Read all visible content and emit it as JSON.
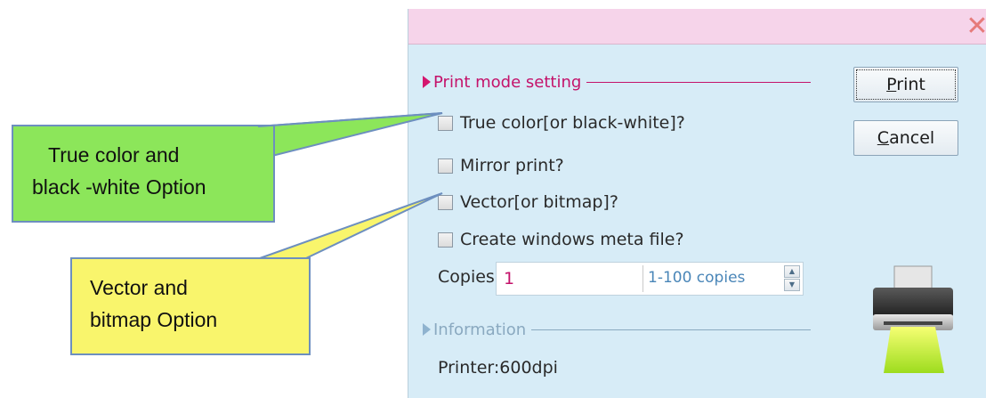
{
  "dialog": {
    "close_glyph": "✕",
    "print_mode_section": "Print mode setting",
    "options": [
      {
        "label": "True color[or black-white]?",
        "checked": false
      },
      {
        "label": "Mirror print?",
        "checked": false
      },
      {
        "label": "Vector[or bitmap]?",
        "checked": false
      },
      {
        "label": "Create windows meta file?",
        "checked": false
      }
    ],
    "copies_label": "Copies:",
    "copies_value": "1",
    "copies_hint": "1-100 copies",
    "information_section": "Information",
    "printer_info": "Printer:600dpi",
    "buttons": {
      "print_label": "rint",
      "print_mnemonic": "P",
      "cancel_label": "ancel",
      "cancel_mnemonic": "C"
    },
    "icons": [
      "close-icon",
      "printer-icon",
      "spin-up-icon",
      "spin-down-icon"
    ]
  },
  "callouts": [
    {
      "line1": "True color and",
      "line2": "black -white Option",
      "color": "#8ce65a"
    },
    {
      "line1": "Vector and",
      "line2": "bitmap Option",
      "color": "#f9f56c"
    }
  ],
  "colors": {
    "accent": "#c4126a",
    "titlebar": "#f6d4ea",
    "dialog_bg": "#d7ecf7",
    "info_text": "#8aa9c0"
  }
}
